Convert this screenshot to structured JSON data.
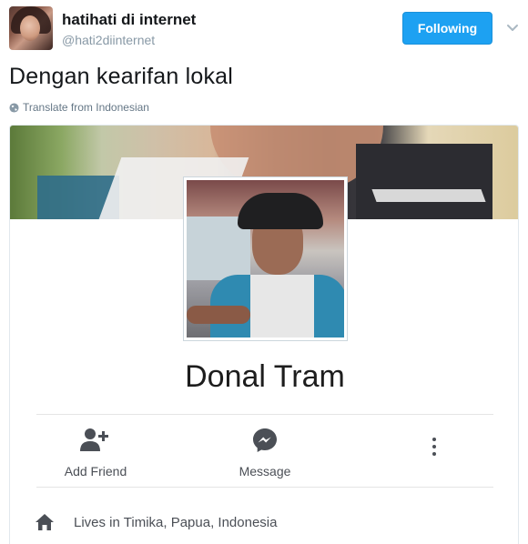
{
  "tweet": {
    "author": {
      "display_name": "hatihati di internet",
      "handle": "@hati2diinternet",
      "avatar_icon": "user-avatar-photo"
    },
    "follow_button_label": "Following",
    "follow_button_color": "#1da1f2",
    "menu_icon": "chevron-down-icon",
    "text": "Dengan kearifan lokal",
    "translate_label": "Translate from Indonesian",
    "translate_icon": "globe-icon"
  },
  "profile_card": {
    "name": "Donal Tram",
    "actions": [
      {
        "label": "Add Friend",
        "icon": "add-friend-icon"
      },
      {
        "label": "Message",
        "icon": "messenger-icon"
      },
      {
        "label": "",
        "icon": "more-options-icon"
      }
    ],
    "location": {
      "icon": "home-icon",
      "text": "Lives in Timika, Papua, Indonesia"
    }
  }
}
